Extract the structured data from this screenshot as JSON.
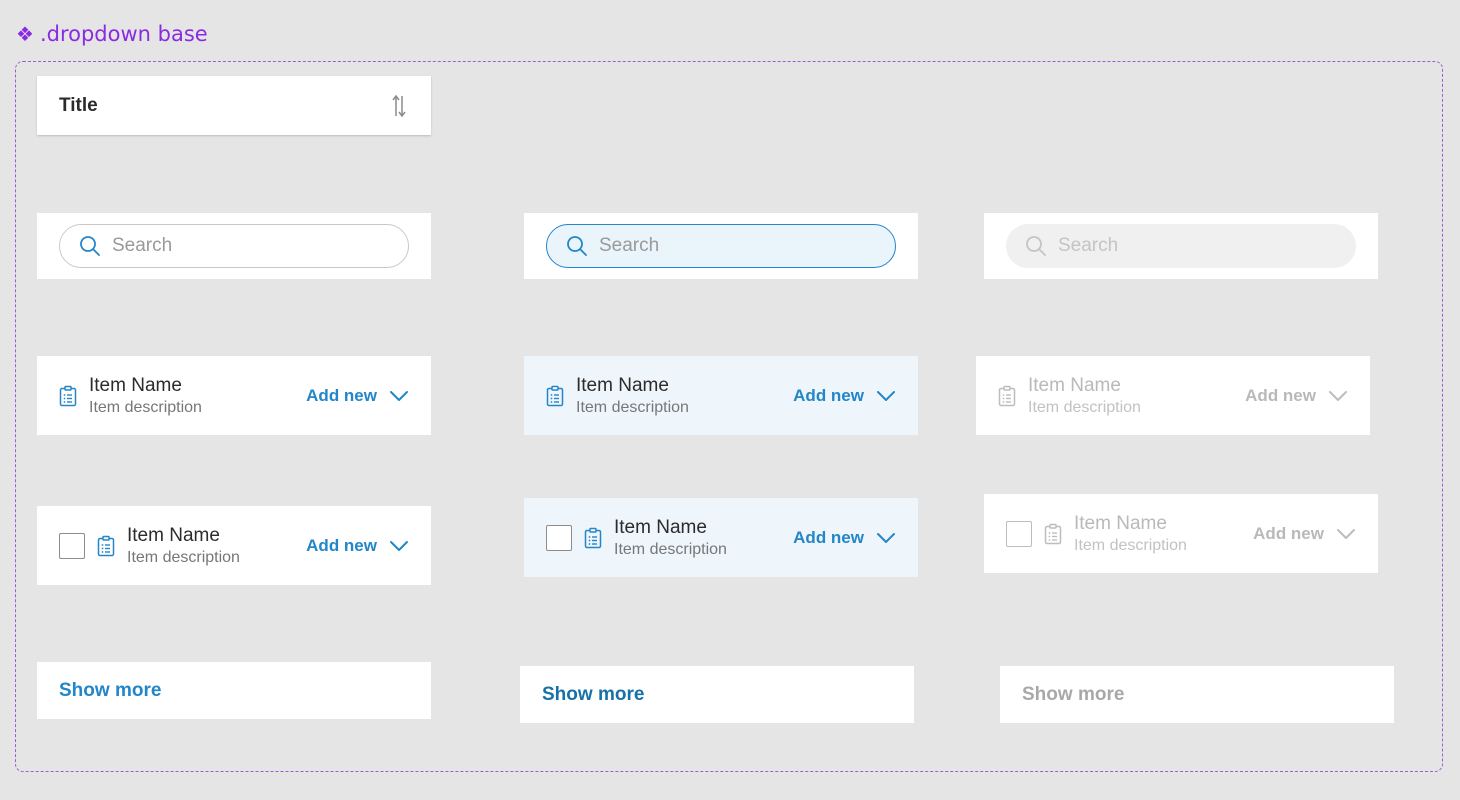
{
  "frame": {
    "label": ".dropdown base",
    "glyph": "❖"
  },
  "title_card": {
    "title": "Title",
    "icon": "sort-arrows-icon"
  },
  "search": {
    "placeholder": "Search",
    "icon": "search-icon"
  },
  "item": {
    "name": "Item Name",
    "description": "Item description",
    "action": "Add new",
    "icon": "clipboard-list-icon",
    "expand_icon": "chevron-down-icon"
  },
  "show_more": {
    "label": "Show more"
  },
  "colors": {
    "accent": "#2386c8",
    "hover_bg": "#eef5fb",
    "disabled_text": "#b9b9b9",
    "frame_border": "#9b5cd6"
  }
}
